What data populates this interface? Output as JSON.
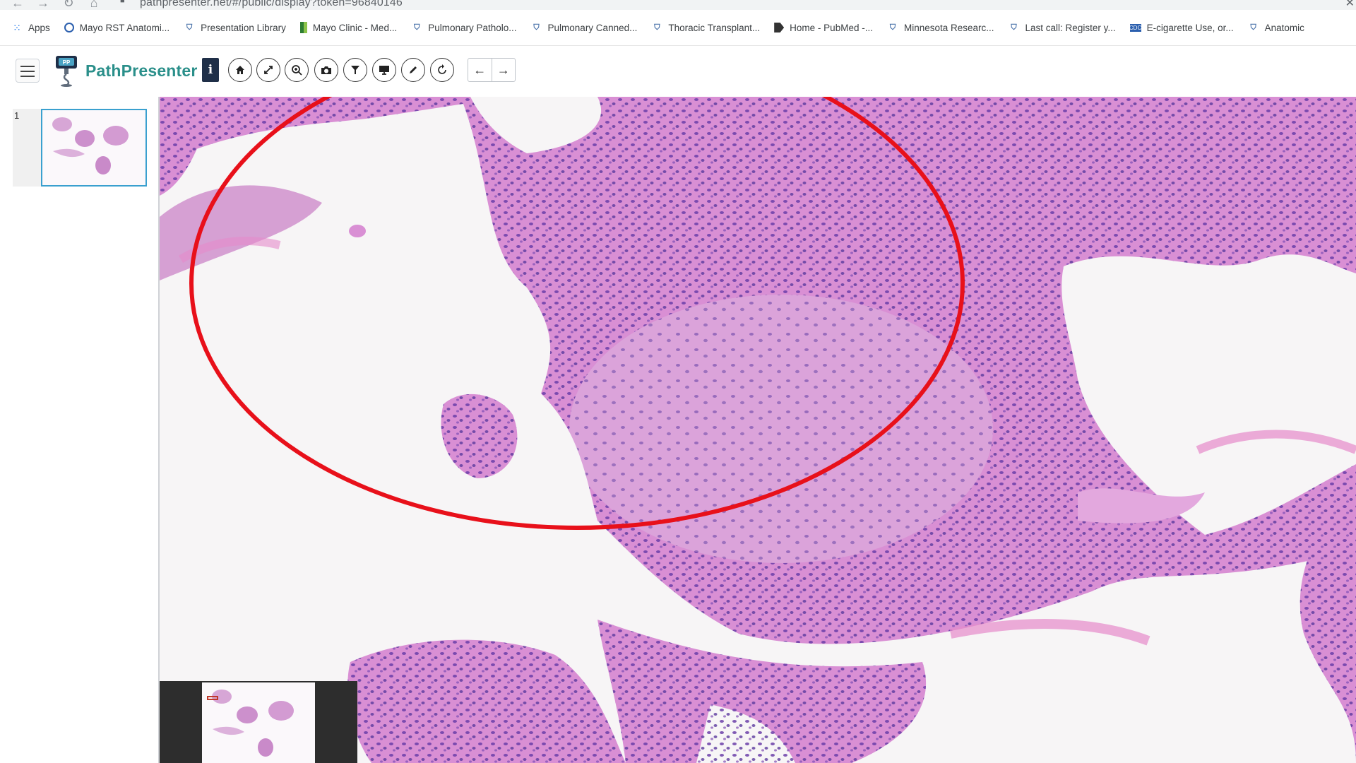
{
  "browser": {
    "url": "pathpresenter.net/#/public/display?token=96840146",
    "bookmarks": [
      {
        "label": "Apps",
        "icon": "apps-grid-icon"
      },
      {
        "label": "Mayo RST Anatomi...",
        "icon": "mayo-icon"
      },
      {
        "label": "Presentation Library",
        "icon": "pathpresenter-icon"
      },
      {
        "label": "Mayo Clinic - Med...",
        "icon": "mayo-clinic-icon"
      },
      {
        "label": "Pulmonary Patholo...",
        "icon": "pathpresenter-icon"
      },
      {
        "label": "Pulmonary Canned...",
        "icon": "pathpresenter-icon"
      },
      {
        "label": "Thoracic Transplant...",
        "icon": "pathpresenter-icon"
      },
      {
        "label": "Home - PubMed -...",
        "icon": "pubmed-icon"
      },
      {
        "label": "Minnesota Researc...",
        "icon": "pathpresenter-icon"
      },
      {
        "label": "Last call: Register y...",
        "icon": "pathpresenter-icon"
      },
      {
        "label": "E-cigarette Use, or...",
        "icon": "cdc-icon"
      },
      {
        "label": "Anatomic",
        "icon": "pathpresenter-icon"
      }
    ]
  },
  "app": {
    "name": "PathPresenter",
    "toolbar": {
      "info_label": "i",
      "tools": [
        "home-icon",
        "fullscreen-icon",
        "zoom-icon",
        "camera-icon",
        "filter-icon",
        "monitor-icon",
        "pencil-icon",
        "rotate-icon"
      ],
      "prev_label": "←",
      "next_label": "→"
    },
    "thumbnails": [
      {
        "number": "1"
      }
    ]
  },
  "annotation": {
    "shape": "ellipse",
    "color": "#e8101a"
  },
  "colors": {
    "brand": "#2a8f8a",
    "tissue": "#d98fd4",
    "nuclei": "#5b3a9e",
    "selection": "#3aa0cf"
  }
}
